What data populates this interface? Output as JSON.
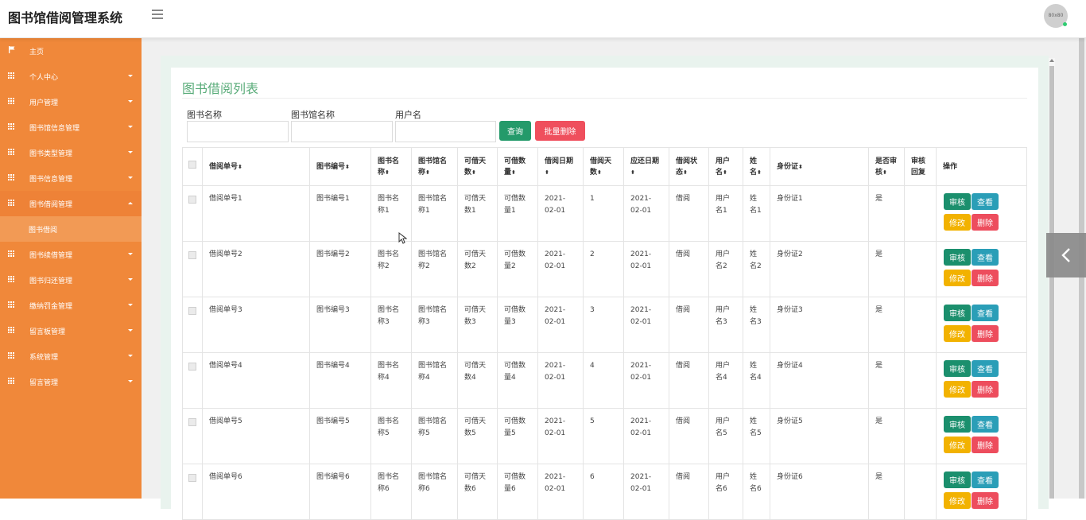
{
  "header": {
    "app_title": "图书馆借阅管理系统",
    "avatar_text": "80x80"
  },
  "sidebar": {
    "items": [
      {
        "label": "主页",
        "icon": "flag-icon"
      },
      {
        "label": "个人中心",
        "icon": "grid-icon"
      },
      {
        "label": "用户管理",
        "icon": "grid-icon"
      },
      {
        "label": "图书馆信息管理",
        "icon": "grid-icon"
      },
      {
        "label": "图书类型管理",
        "icon": "grid-icon"
      },
      {
        "label": "图书信息管理",
        "icon": "grid-icon"
      },
      {
        "label": "图书借阅管理",
        "icon": "grid-icon",
        "expanded": true
      },
      {
        "label": "图书续借管理",
        "icon": "grid-icon"
      },
      {
        "label": "图书归还管理",
        "icon": "grid-icon"
      },
      {
        "label": "缴纳罚金管理",
        "icon": "grid-icon"
      },
      {
        "label": "留言板管理",
        "icon": "grid-icon"
      },
      {
        "label": "系统管理",
        "icon": "grid-icon"
      },
      {
        "label": "留言管理",
        "icon": "grid-icon"
      }
    ],
    "sub_item": "图书借阅"
  },
  "main": {
    "title": "图书借阅列表",
    "search": {
      "book_name_label": "图书名称",
      "library_name_label": "图书馆名称",
      "username_label": "用户名",
      "book_name_value": "",
      "library_name_value": "",
      "username_value": ""
    },
    "buttons": {
      "query": "查询",
      "batch_delete": "批量删除"
    },
    "table": {
      "columns": [
        "借阅单号",
        "图书编号",
        "图书名称",
        "图书馆名称",
        "可借天数",
        "可借数量",
        "借阅日期",
        "借阅天数",
        "应还日期",
        "借阅状态",
        "用户名",
        "姓名",
        "身份证",
        "是否审核",
        "审核回复",
        "操作"
      ],
      "sortable": [
        true,
        true,
        true,
        true,
        true,
        true,
        true,
        true,
        true,
        true,
        true,
        true,
        true,
        true,
        false,
        false
      ],
      "rows": [
        [
          "借阅单号1",
          "图书编号1",
          "图书名称1",
          "图书馆名称1",
          "可借天数1",
          "可借数量1",
          "2021-02-01",
          "1",
          "2021-02-01",
          "借阅",
          "用户名1",
          "姓名1",
          "身份证1",
          "是",
          ""
        ],
        [
          "借阅单号2",
          "图书编号2",
          "图书名称2",
          "图书馆名称2",
          "可借天数2",
          "可借数量2",
          "2021-02-01",
          "2",
          "2021-02-01",
          "借阅",
          "用户名2",
          "姓名2",
          "身份证2",
          "是",
          ""
        ],
        [
          "借阅单号3",
          "图书编号3",
          "图书名称3",
          "图书馆名称3",
          "可借天数3",
          "可借数量3",
          "2021-02-01",
          "3",
          "2021-02-01",
          "借阅",
          "用户名3",
          "姓名3",
          "身份证3",
          "是",
          ""
        ],
        [
          "借阅单号4",
          "图书编号4",
          "图书名称4",
          "图书馆名称4",
          "可借天数4",
          "可借数量4",
          "2021-02-01",
          "4",
          "2021-02-01",
          "借阅",
          "用户名4",
          "姓名4",
          "身份证4",
          "是",
          ""
        ],
        [
          "借阅单号5",
          "图书编号5",
          "图书名称5",
          "图书馆名称5",
          "可借天数5",
          "可借数量5",
          "2021-02-01",
          "5",
          "2021-02-01",
          "借阅",
          "用户名5",
          "姓名5",
          "身份证5",
          "是",
          ""
        ],
        [
          "借阅单号6",
          "图书编号6",
          "图书名称6",
          "图书馆名称6",
          "可借天数6",
          "可借数量6",
          "2021-02-01",
          "6",
          "2021-02-01",
          "借阅",
          "用户名6",
          "姓名6",
          "身份证6",
          "是",
          ""
        ]
      ],
      "actions": {
        "audit": "审核",
        "view": "查看",
        "edit": "修改",
        "delete": "删除"
      }
    }
  },
  "colors": {
    "sidebar_bg": "#f0883a",
    "title_green": "#5aac7a",
    "query_btn": "#249a6a",
    "danger": "#ef4f5d",
    "audit_btn": "#1b8f6d",
    "view_btn": "#2a9eb7",
    "edit_btn": "#f2b200"
  }
}
